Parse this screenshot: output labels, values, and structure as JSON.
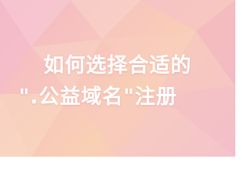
{
  "banner": {
    "title_line1": "如何选择合适的",
    "title_line2": "\".公益域名\"注册",
    "text_color": "#ffffff",
    "background_colors": [
      "#f3b7c8",
      "#f7c5bd",
      "#f8d0b4",
      "#f4c2cf"
    ]
  }
}
